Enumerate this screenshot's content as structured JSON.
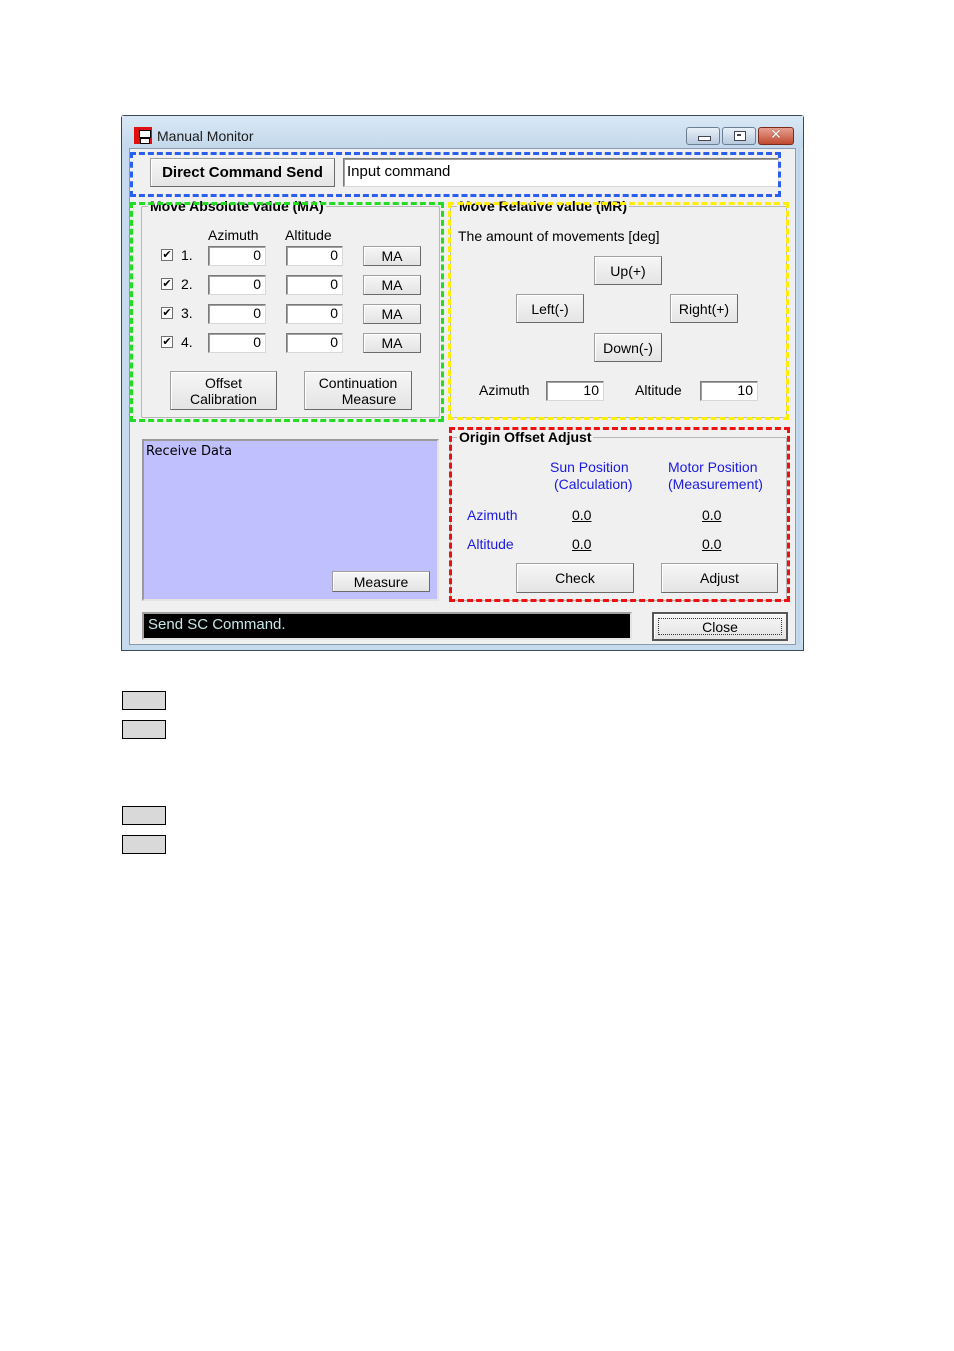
{
  "window": {
    "title": "Manual Monitor",
    "controls": {
      "minimize": "minimize",
      "maximize": "maximize",
      "close": "✕"
    }
  },
  "direct_command": {
    "button_label": "Direct Command Send",
    "input_value": "Input command"
  },
  "move_absolute": {
    "title": "Move Absolute value (MA)",
    "col_azimuth": "Azimuth",
    "col_altitude": "Altitude",
    "rows": [
      {
        "label": "1.",
        "checked": true,
        "azimuth": "0",
        "altitude": "0",
        "button": "MA"
      },
      {
        "label": "2.",
        "checked": true,
        "azimuth": "0",
        "altitude": "0",
        "button": "MA"
      },
      {
        "label": "3.",
        "checked": true,
        "azimuth": "0",
        "altitude": "0",
        "button": "MA"
      },
      {
        "label": "4.",
        "checked": true,
        "azimuth": "0",
        "altitude": "0",
        "button": "MA"
      }
    ],
    "offset_calibration_line1": "Offset",
    "offset_calibration_line2": "Calibration",
    "continuation_measure_line1": "Continuation",
    "continuation_measure_line2": "Measure"
  },
  "move_relative": {
    "title": "Move Relative value (MR)",
    "description": "The amount of movements [deg]",
    "up": "Up(+)",
    "left": "Left(-)",
    "right": "Right(+)",
    "down": "Down(-)",
    "azimuth_label": "Azimuth",
    "azimuth_value": "10",
    "altitude_label": "Altitude",
    "altitude_value": "10"
  },
  "receive": {
    "label": "Receive Data",
    "measure_button": "Measure"
  },
  "origin_offset": {
    "title": "Origin Offset Adjust",
    "sun_header_line1": "Sun Position",
    "sun_header_line2": "(Calculation)",
    "motor_header_line1": "Motor Position",
    "motor_header_line2": "(Measurement)",
    "azimuth_label": "Azimuth",
    "altitude_label": "Altitude",
    "sun_azimuth": "0.0",
    "motor_azimuth": "0.0",
    "sun_altitude": "0.0",
    "motor_altitude": "0.0",
    "check_button": "Check",
    "adjust_button": "Adjust"
  },
  "status_bar": {
    "message": "Send SC Command."
  },
  "close_button": "Close",
  "highlight_colors": {
    "direct_command": "#2a5ef0",
    "move_absolute": "#22dd22",
    "move_relative": "#ffee00",
    "origin_offset": "#ee1111"
  },
  "legend_swatches": 4
}
